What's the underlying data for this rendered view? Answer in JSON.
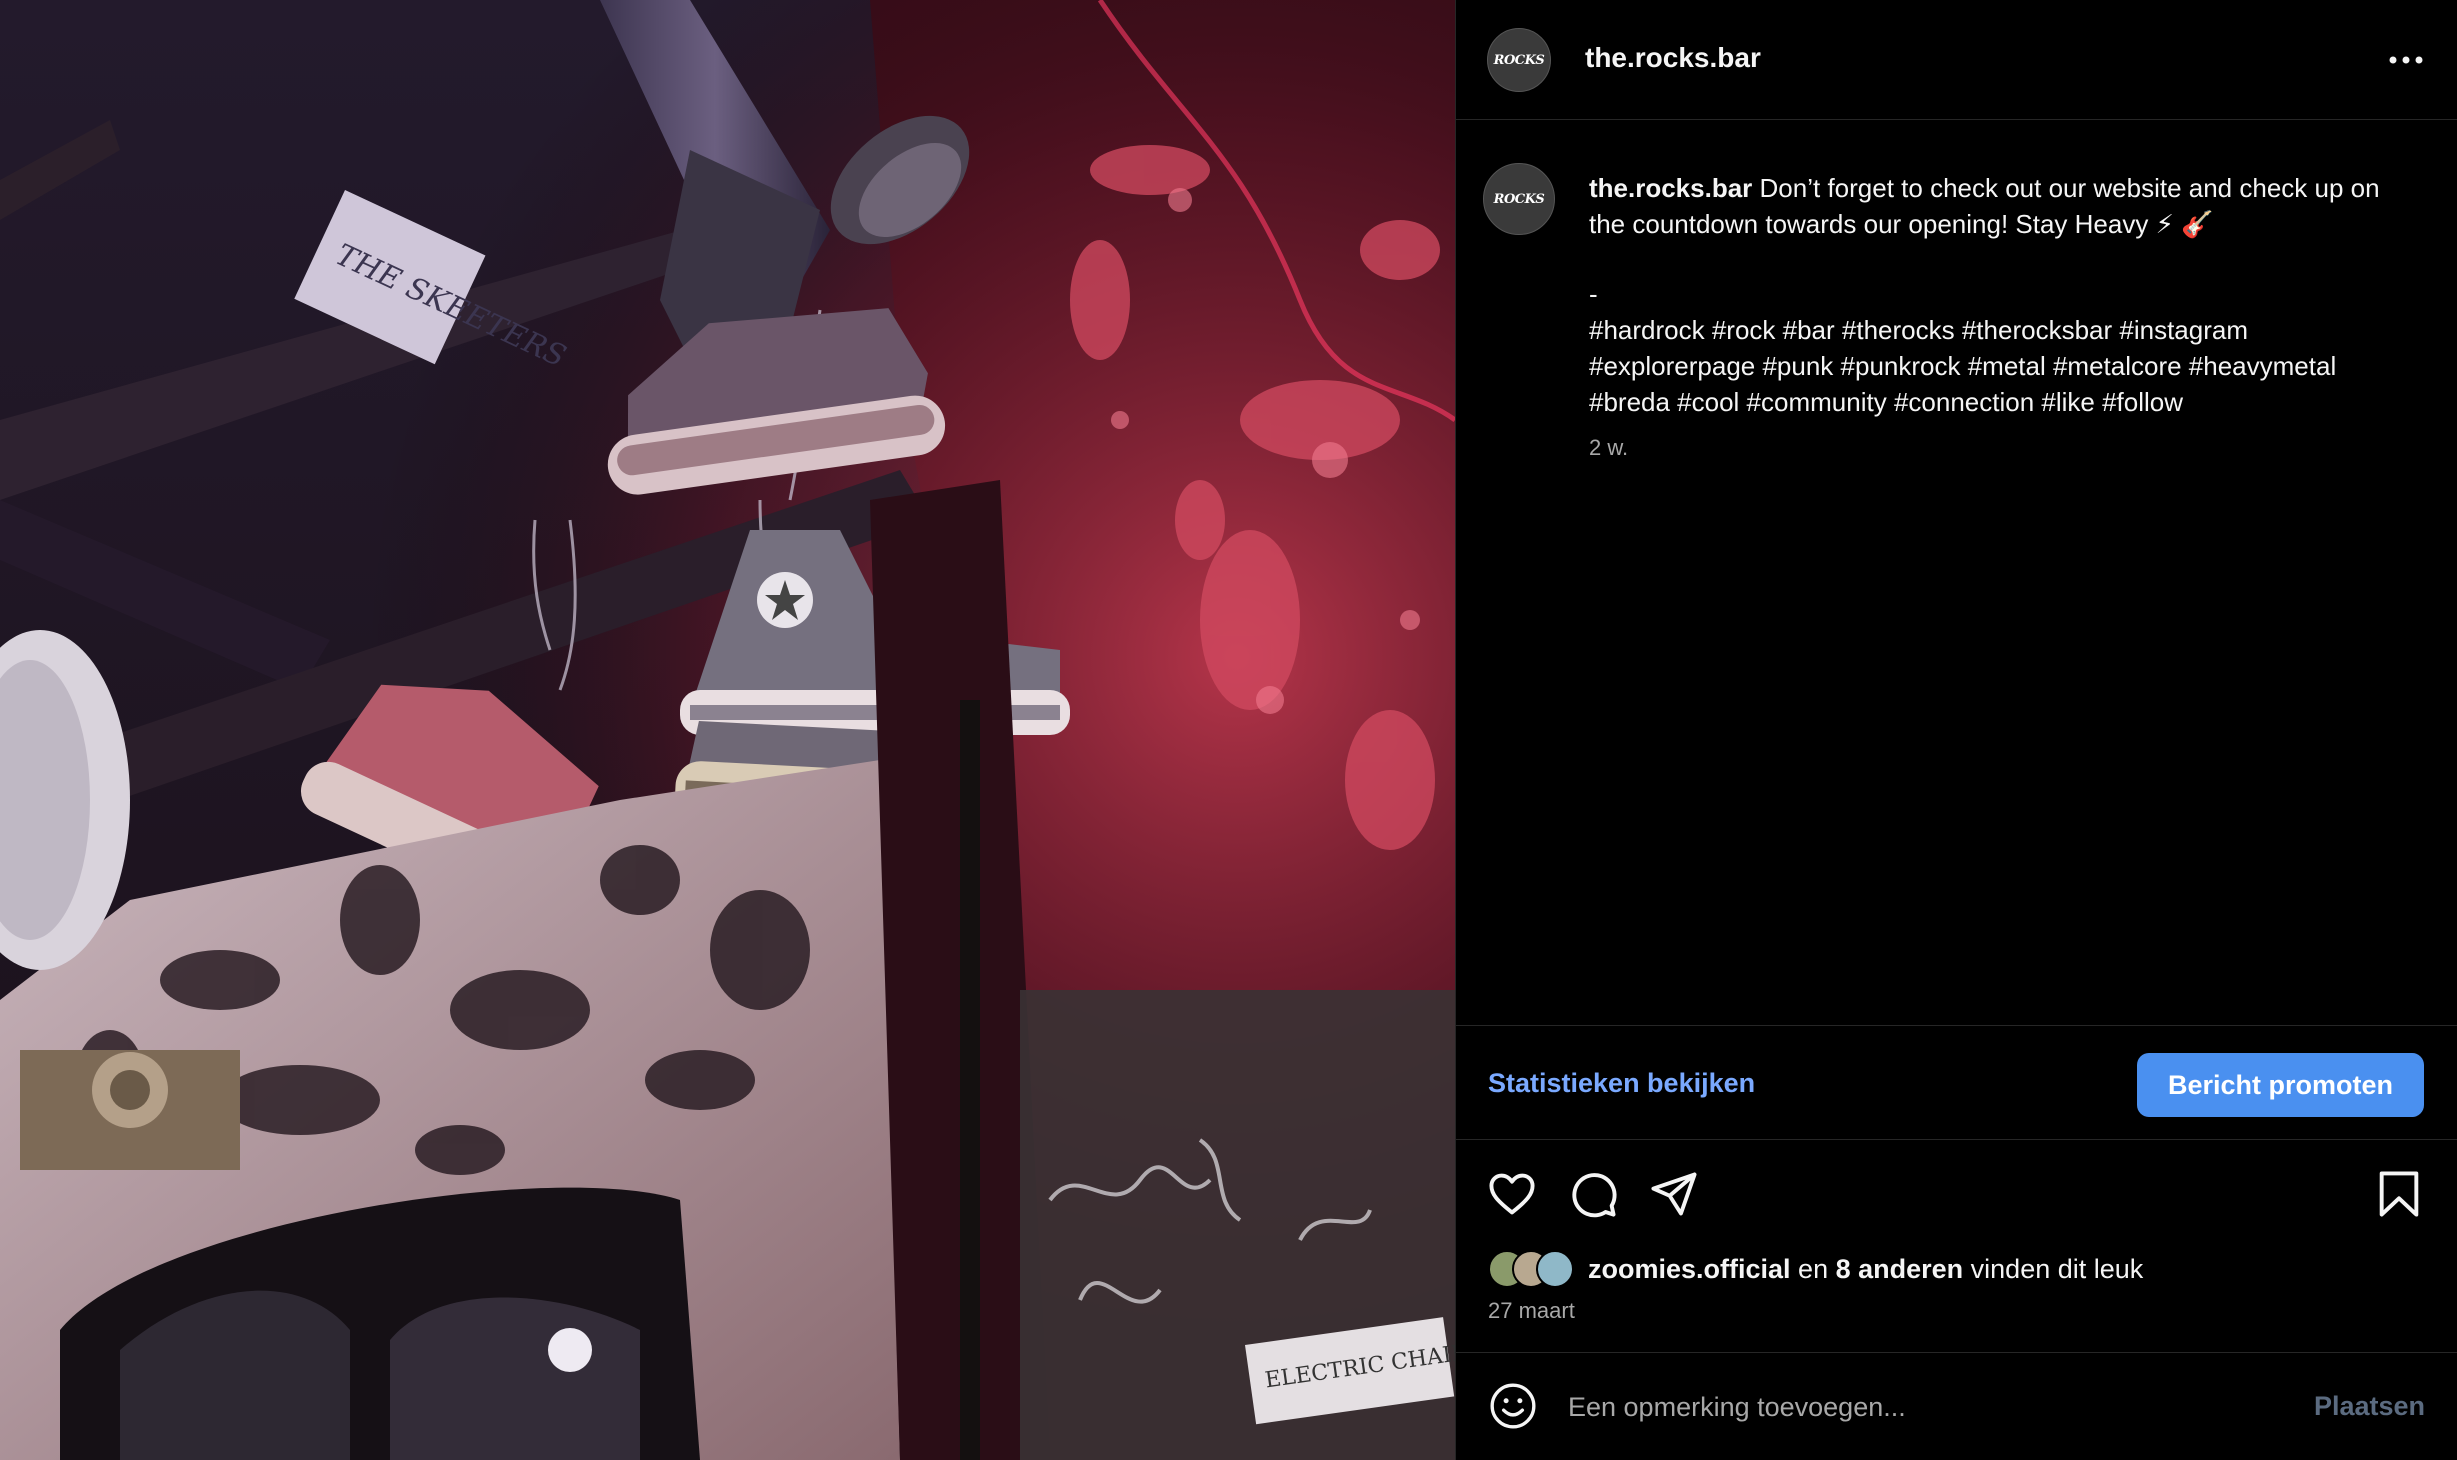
{
  "post": {
    "username": "the.rocks.bar",
    "avatar_logo_text": "ROCKS",
    "image_sign_text": "THE SKEETERS",
    "image_sign2_text": "ELECTRIC CHAIR",
    "caption": {
      "username": "the.rocks.bar",
      "text": "Don’t forget to check out our website and check up on the countdown towards our opening! Stay Heavy ⚡ 🎸",
      "dash": "-",
      "hashtags": "#hardrock #rock #bar #therocks #therocksbar #instagram #explorerpage #punk #punkrock #metal #metalcore #heavymetal #breda #cool #community #connection #like #follow",
      "time": "2 w."
    },
    "insights_label": "Statistieken bekijken",
    "promote_label": "Bericht promoten",
    "likes": {
      "first_user": "zoomies.official",
      "connector": " en ",
      "others": "8 anderen",
      "suffix": " vinden dit leuk"
    },
    "date": "27 maart",
    "comment_placeholder": "Een opmerking toevoegen...",
    "post_button": "Plaatsen"
  },
  "icons": {
    "more": "more-options-icon",
    "like": "heart-icon",
    "comment": "comment-icon",
    "share": "share-icon",
    "save": "bookmark-icon",
    "emoji": "emoji-icon"
  },
  "colors": {
    "accent": "#4a90f0",
    "link": "#7aa9ff",
    "muted": "#a8a8a8",
    "background": "#000000"
  }
}
